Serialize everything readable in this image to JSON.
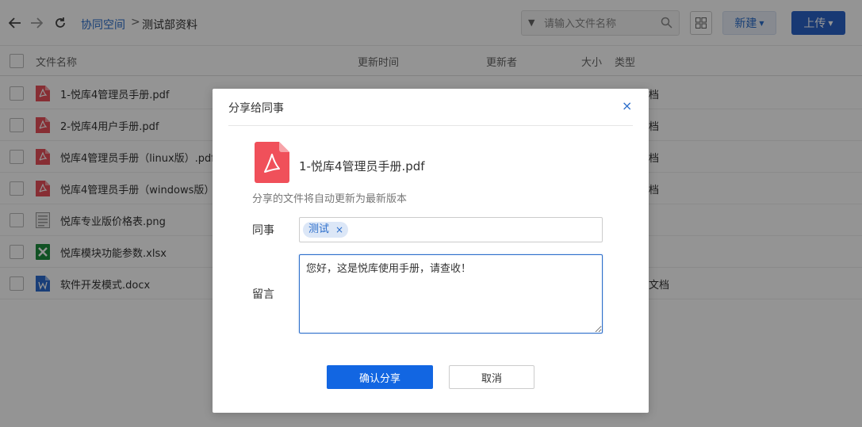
{
  "toolbar": {
    "breadcrumb_link": "协同空间",
    "breadcrumb_sep": ">",
    "breadcrumb_current": "测试部资料",
    "search_placeholder": "请输入文件名称",
    "new_label": "新建",
    "upload_label": "上传"
  },
  "table": {
    "headers": {
      "name": "文件名称",
      "updated_time": "更新时间",
      "updater": "更新者",
      "size": "大小",
      "type": "类型"
    },
    "rows": [
      {
        "name": "1-悦库4管理员手册.pdf",
        "icon": "pdf-icon",
        "type_visible": "档"
      },
      {
        "name": "2-悦库4用户手册.pdf",
        "icon": "pdf-icon",
        "type_visible": "档"
      },
      {
        "name": "悦库4管理员手册（linux版）.pdf",
        "icon": "pdf-icon",
        "type_visible": "档"
      },
      {
        "name": "悦库4管理员手册（windows版）",
        "icon": "pdf-icon",
        "type_visible": "档"
      },
      {
        "name": "悦库专业版价格表.png",
        "icon": "image-icon",
        "type_visible": ""
      },
      {
        "name": "悦库模块功能参数.xlsx",
        "icon": "excel-icon",
        "type_visible": ""
      },
      {
        "name": "软件开发模式.docx",
        "icon": "word-icon",
        "type_visible": "文档"
      }
    ]
  },
  "dialog": {
    "title": "分享给同事",
    "close": "×",
    "file_name": "1-悦库4管理员手册.pdf",
    "hint": "分享的文件将自动更新为最新版本",
    "colleague_label": "同事",
    "colleague_tag": "测试",
    "tag_remove": "×",
    "message_label": "留言",
    "message_value": "您好，这是悦库使用手册，请查收！",
    "confirm_label": "确认分享",
    "cancel_label": "取消"
  },
  "colors": {
    "accent": "#2c6ecb",
    "primary_button": "#1266e2",
    "pdf_red": "#f0505a",
    "excel_green": "#1e8e3e",
    "word_blue": "#2b6ccf"
  }
}
